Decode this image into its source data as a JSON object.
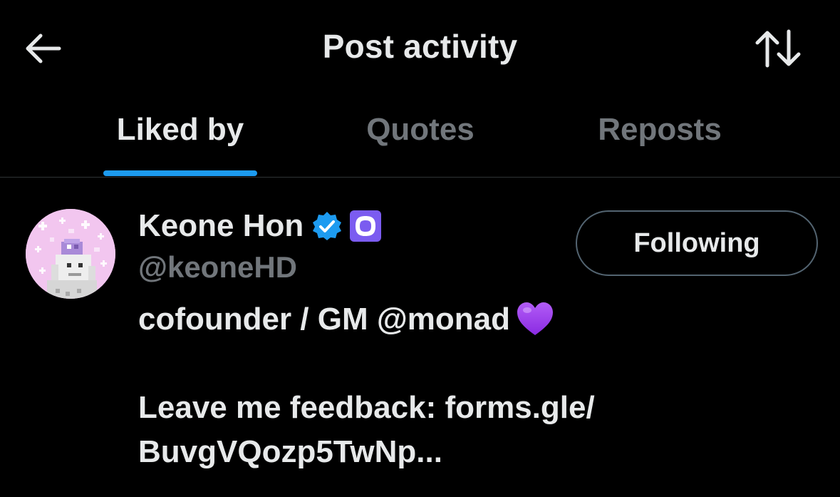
{
  "header": {
    "title": "Post activity",
    "back_icon": "arrow-left-icon",
    "sort_icon": "sort-arrows-icon"
  },
  "tabs": [
    {
      "label": "Liked by",
      "active": true
    },
    {
      "label": "Quotes",
      "active": false
    },
    {
      "label": "Reposts",
      "active": false
    }
  ],
  "user": {
    "display_name": "Keone Hon",
    "handle": "@keoneHD",
    "verified_icon": "verified-badge-icon",
    "affiliate_icon": "affiliate-badge-icon",
    "follow_label": "Following",
    "bio_line_1": "cofounder / GM @monad",
    "bio_line_2": "Leave me feedback: forms.gle/",
    "bio_line_3": "BuvgVQozp5TwNp..."
  },
  "colors": {
    "background": "#000000",
    "text_primary": "#e7e9ea",
    "text_secondary": "#71767b",
    "accent": "#1d9bf0",
    "affiliate_purple": "#7b5cf0",
    "heart_purple": "#9b3ef2"
  }
}
